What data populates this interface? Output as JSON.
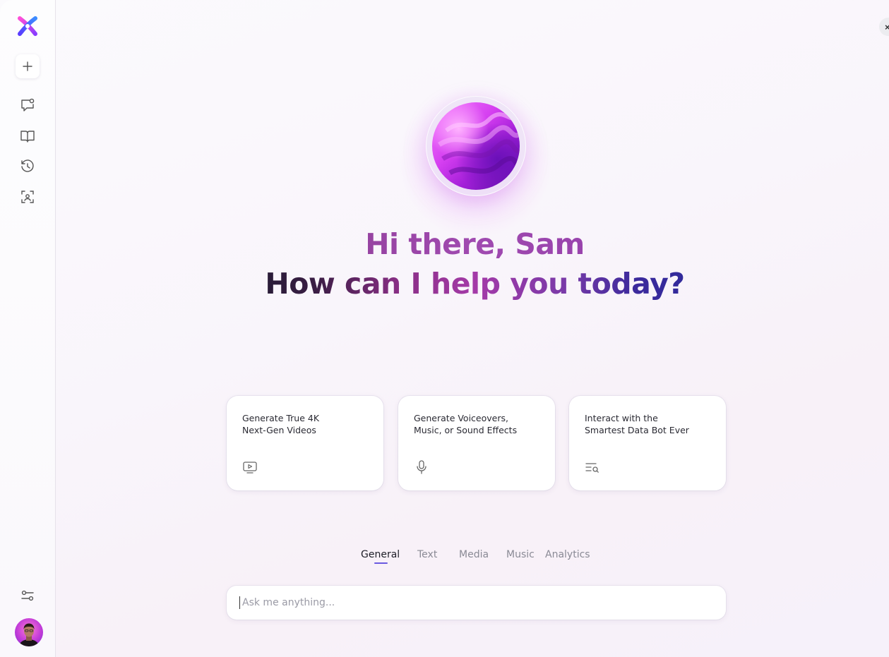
{
  "sidebar": {
    "items": [
      {
        "name": "new-chat",
        "icon": "plus-icon"
      },
      {
        "name": "chats",
        "icon": "chat-bubble-icon"
      },
      {
        "name": "library",
        "icon": "book-icon"
      },
      {
        "name": "history",
        "icon": "history-icon"
      },
      {
        "name": "scan",
        "icon": "scan-icon"
      }
    ],
    "settings_icon": "sliders-icon"
  },
  "greeting": {
    "line1": "Hi there, Sam",
    "line2": "How can I help you today?"
  },
  "cards": [
    {
      "title": "Generate True 4K\nNext-Gen Videos",
      "icon": "video-icon"
    },
    {
      "title": "Generate Voiceovers,\nMusic, or Sound Effects",
      "icon": "microphone-icon"
    },
    {
      "title": "Interact with the\nSmartest Data Bot Ever",
      "icon": "list-search-icon"
    }
  ],
  "tabs": [
    {
      "label": "General",
      "active": true
    },
    {
      "label": "Text",
      "active": false
    },
    {
      "label": "Media",
      "active": false
    },
    {
      "label": "Music",
      "active": false
    },
    {
      "label": "Analytics",
      "active": false
    }
  ],
  "input": {
    "placeholder": "Ask me anything..."
  },
  "colors": {
    "accent": "#6b5ae0",
    "greeting_primary": "#9a3fa8",
    "orb": "#d43ef0"
  }
}
